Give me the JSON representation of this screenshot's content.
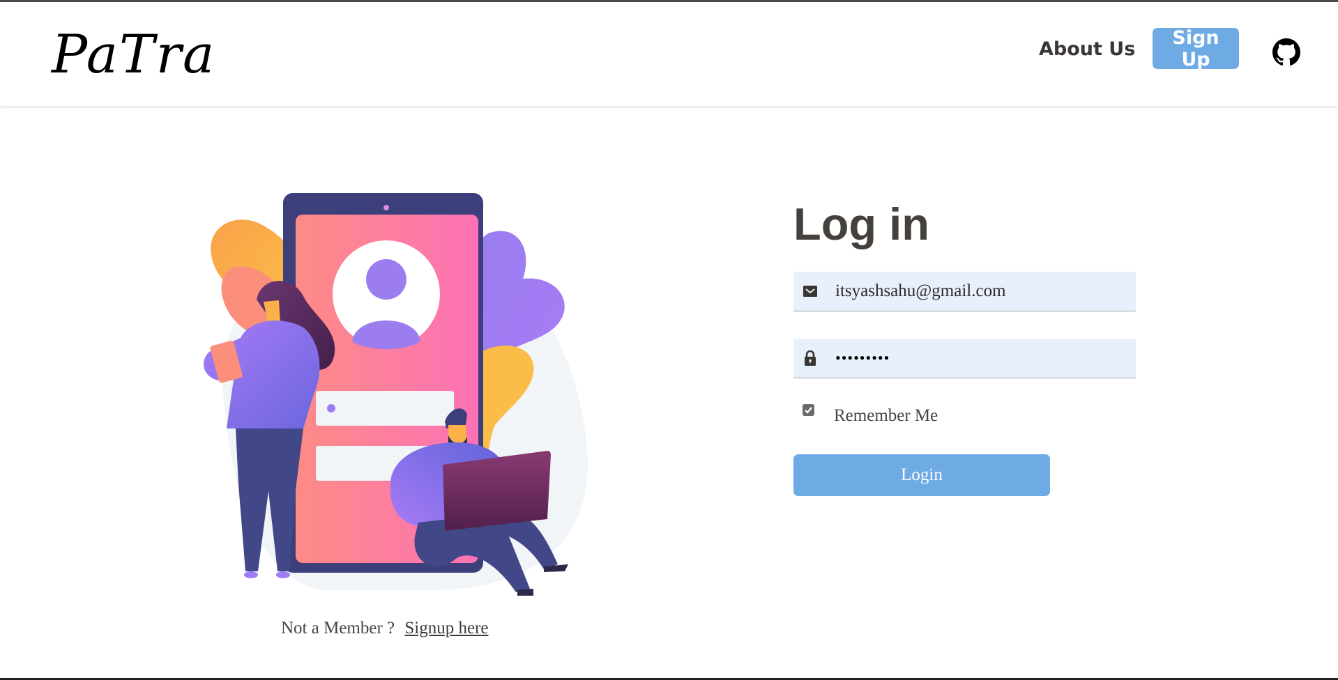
{
  "header": {
    "logo": "PaTra",
    "nav": {
      "about_label": "About Us",
      "signup_label": "Sign Up",
      "github_icon": "github-icon"
    }
  },
  "illustration": {
    "description": "Two people beside a large phone showing a user-profile login screen",
    "icon": "login-illustration"
  },
  "signup_prompt": {
    "text": "Not a Member ?",
    "link_label": "Signup here"
  },
  "login_form": {
    "title": "Log in",
    "email": {
      "icon": "envelope-icon",
      "value": "itsyashsahu@gmail.com"
    },
    "password": {
      "icon": "lock-icon",
      "value": "•••••••••"
    },
    "remember_me": {
      "label": "Remember Me",
      "checked": true
    },
    "submit_label": "Login"
  },
  "colors": {
    "accent": "#6eaae3",
    "input_bg": "#e8f0fc",
    "title_text": "#45403b"
  }
}
